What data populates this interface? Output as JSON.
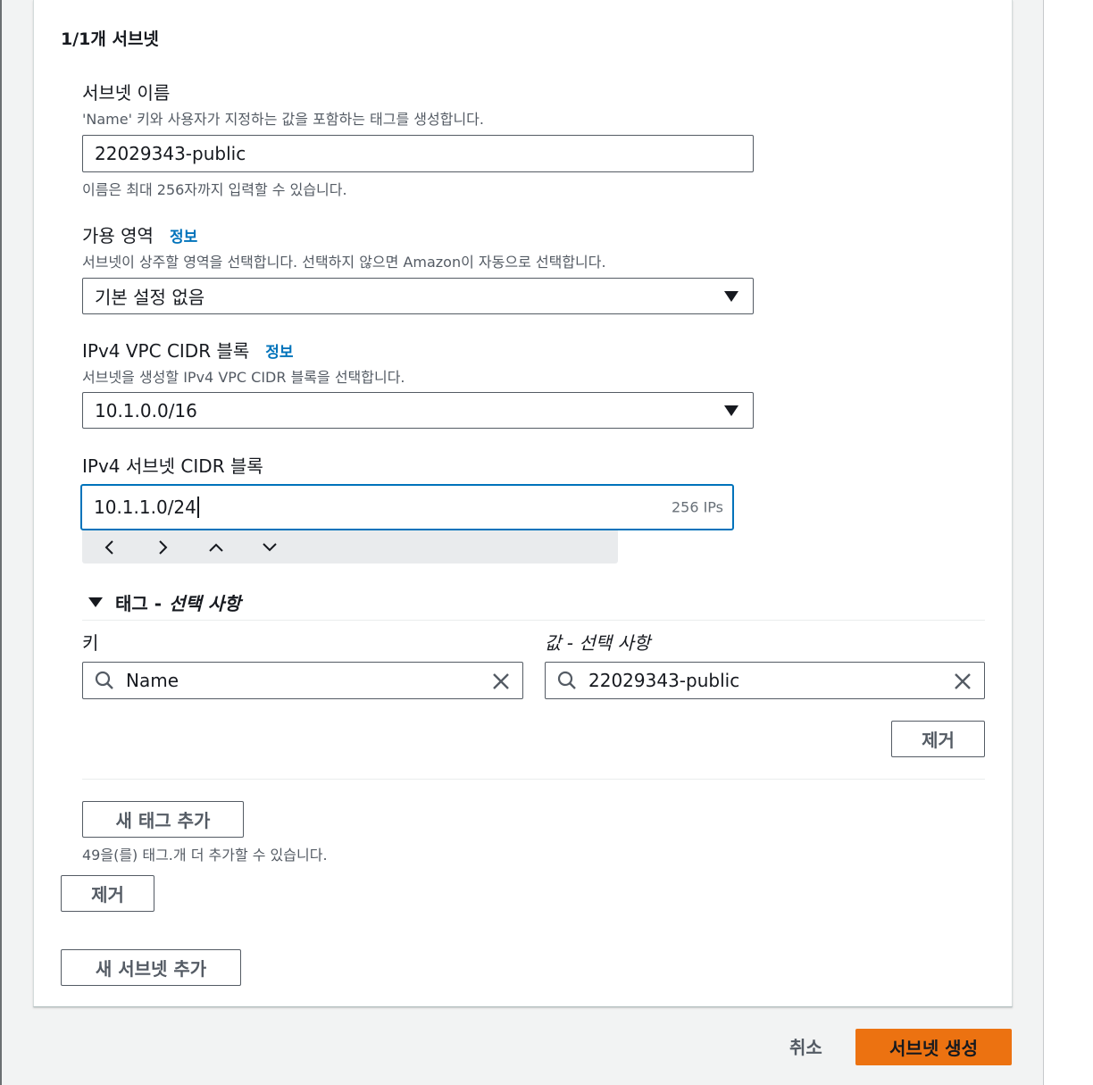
{
  "form": {
    "heading": "1/1개 서브넷",
    "subnet_name": {
      "label": "서브넷 이름",
      "description": "'Name' 키와 사용자가 지정하는 값을 포함하는 태그를 생성합니다.",
      "value": "22029343-public",
      "constraint": "이름은 최대 256자까지 입력할 수 있습니다."
    },
    "availability_zone": {
      "label": "가용 영역",
      "info": "정보",
      "description": "서브넷이 상주할 영역을 선택합니다. 선택하지 않으면 Amazon이 자동으로 선택합니다.",
      "value": "기본 설정 없음"
    },
    "vpc_cidr": {
      "label": "IPv4 VPC CIDR 블록",
      "info": "정보",
      "description": "서브넷을 생성할 IPv4 VPC CIDR 블록을 선택합니다.",
      "value": "10.1.0.0/16"
    },
    "subnet_cidr": {
      "label": "IPv4 서브넷 CIDR 블록",
      "value": "10.1.1.0/24",
      "hint": "256 IPs"
    },
    "tags": {
      "title": "태그 -",
      "title_optional": "선택 사항",
      "key_label": "키",
      "value_label": "값 - 선택 사항",
      "key": "Name",
      "value": "22029343-public",
      "remove_tag": "제거",
      "add_tag": "새 태그 추가",
      "remaining": "49을(를) 태그.개 더 추가할 수 있습니다."
    },
    "remove_subnet": "제거",
    "add_subnet": "새 서브넷 추가"
  },
  "footer": {
    "cancel": "취소",
    "create": "서브넷 생성"
  },
  "colors": {
    "primary": "#ec7211",
    "link": "#0073bb",
    "focus": "#0073bb"
  }
}
